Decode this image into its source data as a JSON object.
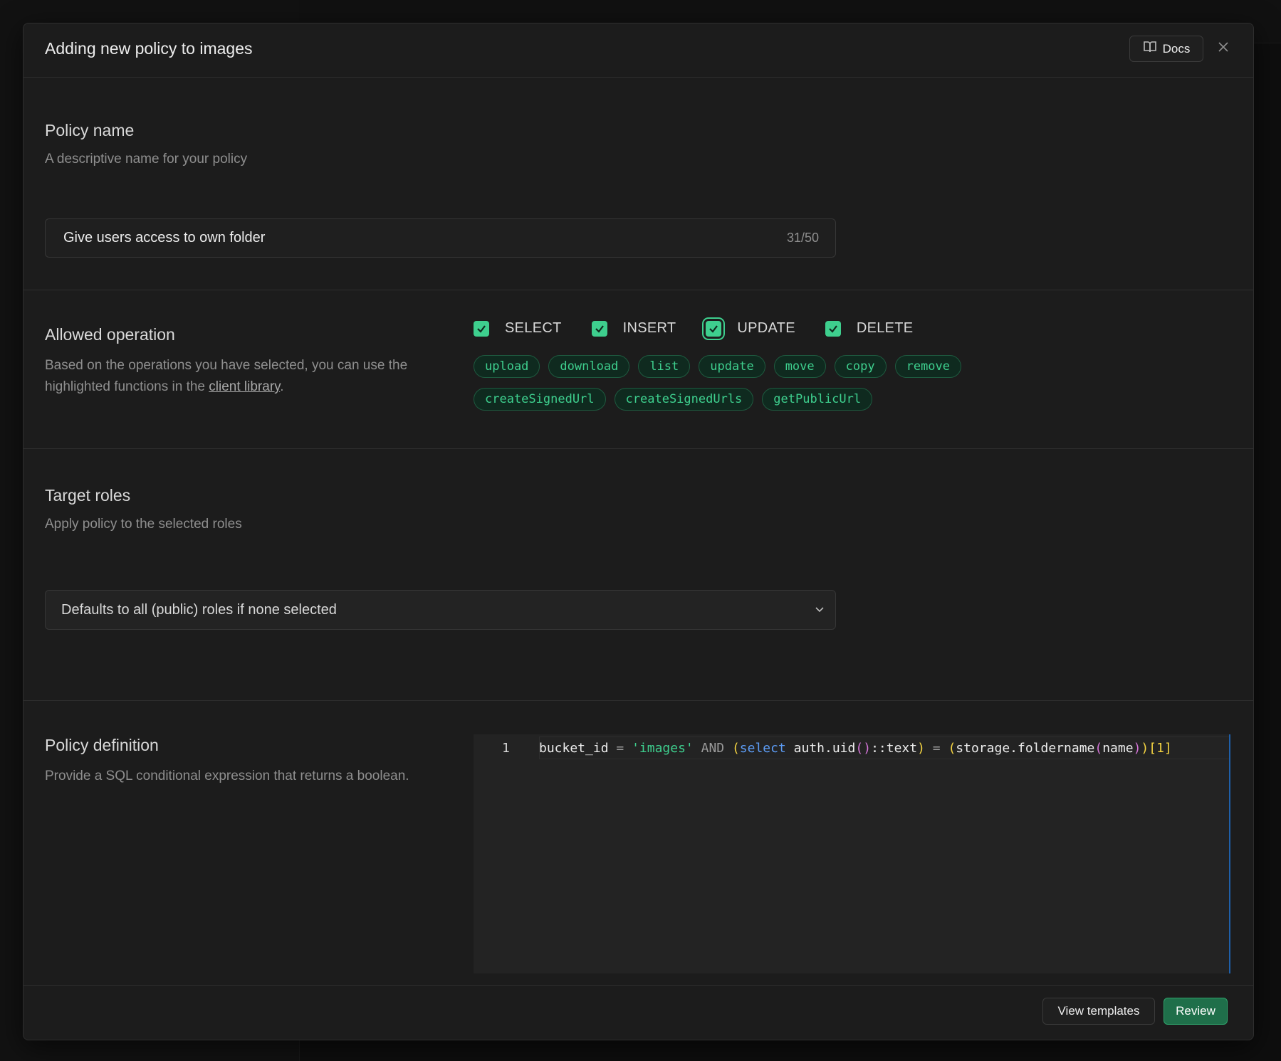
{
  "modal": {
    "title": "Adding new policy to images",
    "docs_label": "Docs",
    "close_icon": "close-icon"
  },
  "policy_name": {
    "title": "Policy name",
    "description": "A descriptive name for your policy",
    "value": "Give users access to own folder",
    "char_count": "31/50"
  },
  "allowed_operation": {
    "title": "Allowed operation",
    "description_prefix": "Based on the operations you have selected, you can use the highlighted functions in the ",
    "description_link": "client library",
    "description_suffix": ".",
    "operations": [
      {
        "label": "SELECT",
        "checked": true
      },
      {
        "label": "INSERT",
        "checked": true
      },
      {
        "label": "UPDATE",
        "checked": true
      },
      {
        "label": "DELETE",
        "checked": true
      }
    ],
    "functions_row1": [
      "upload",
      "download",
      "list",
      "update",
      "move",
      "copy",
      "remove"
    ],
    "functions_row2": [
      "createSignedUrl",
      "createSignedUrls",
      "getPublicUrl"
    ]
  },
  "target_roles": {
    "title": "Target roles",
    "description": "Apply policy to the selected roles",
    "select_value": "Defaults to all (public) roles if none selected"
  },
  "policy_definition": {
    "title": "Policy definition",
    "description": "Provide a SQL conditional expression that returns a boolean.",
    "line_number": "1",
    "tokens": [
      {
        "t": "bucket_id",
        "c": "t-id"
      },
      {
        "t": " = ",
        "c": "t-op"
      },
      {
        "t": "'images'",
        "c": "t-str"
      },
      {
        "t": " AND ",
        "c": "t-op"
      },
      {
        "t": "(",
        "c": "t-p1"
      },
      {
        "t": "select",
        "c": "t-kwb"
      },
      {
        "t": " auth.uid",
        "c": "t-id"
      },
      {
        "t": "()",
        "c": "t-p2"
      },
      {
        "t": "::text",
        "c": "t-id"
      },
      {
        "t": ")",
        "c": "t-p1"
      },
      {
        "t": " = ",
        "c": "t-op"
      },
      {
        "t": "(",
        "c": "t-p1"
      },
      {
        "t": "storage.foldername",
        "c": "t-id"
      },
      {
        "t": "(",
        "c": "t-p2"
      },
      {
        "t": "name",
        "c": "t-id"
      },
      {
        "t": ")",
        "c": "t-p2"
      },
      {
        "t": ")",
        "c": "t-p1"
      },
      {
        "t": "[1]",
        "c": "t-num"
      }
    ]
  },
  "footer": {
    "view_templates_label": "View templates",
    "review_label": "Review"
  },
  "colors": {
    "accent": "#3ecf8e",
    "primary_button": "#1f6f4a",
    "modal_bg": "#1c1c1c",
    "editor_cursor_line": "#1f5fa8"
  }
}
